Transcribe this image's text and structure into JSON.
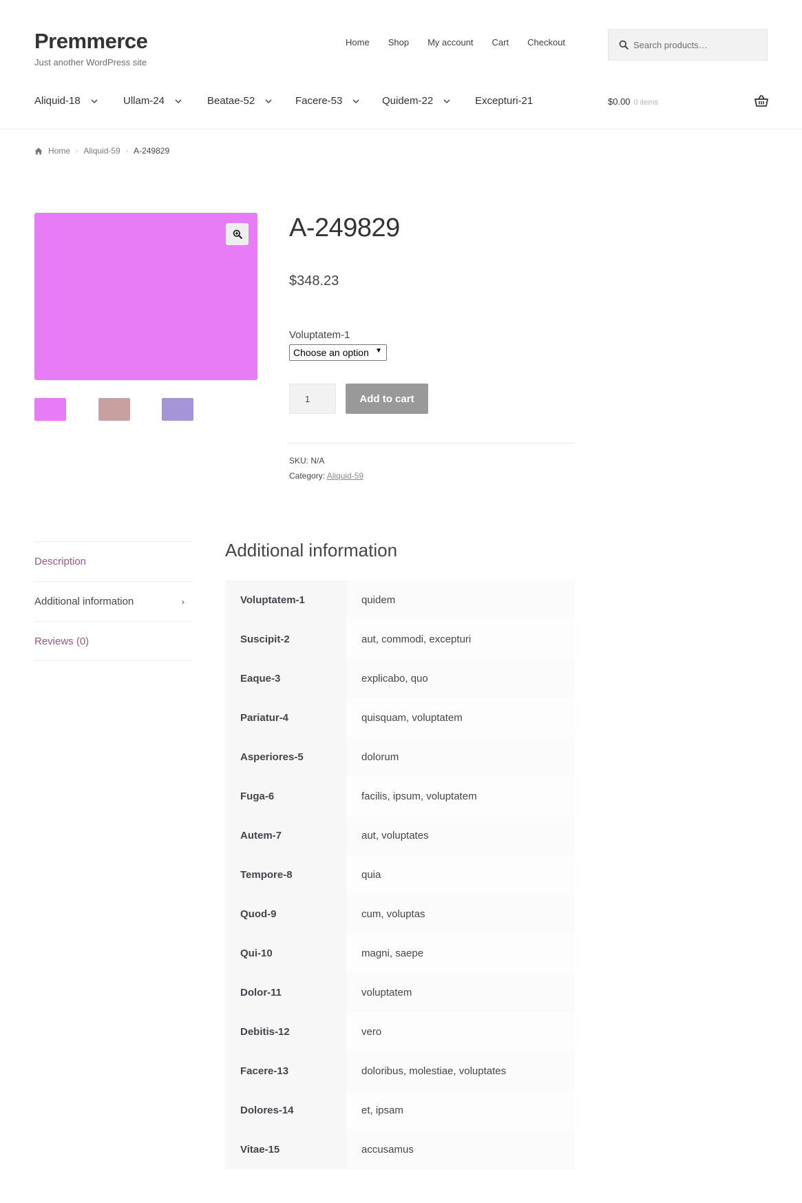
{
  "site": {
    "title": "Premmerce",
    "description": "Just another WordPress site"
  },
  "top_nav": [
    "Home",
    "Shop",
    "My account",
    "Cart",
    "Checkout"
  ],
  "search": {
    "placeholder": "Search products…"
  },
  "categories": [
    "Aliquid-18",
    "Ullam-24",
    "Beatae-52",
    "Facere-53",
    "Quidem-22",
    "Excepturi-21"
  ],
  "cart": {
    "amount": "$0.00",
    "count": "0 items"
  },
  "breadcrumb": {
    "home": "Home",
    "category": "Aliquid-59",
    "current": "A-249829"
  },
  "product": {
    "title": "A-249829",
    "price": "$348.23",
    "variation_label": "Voluptatem-1",
    "variation_selected": "Choose an option",
    "quantity": "1",
    "add_to_cart": "Add to cart",
    "sku_label": "SKU:",
    "sku_value": "N/A",
    "category_label": "Category:",
    "category_value": "Aliquid-59",
    "main_image_color": "#e87cf7",
    "thumb_colors": [
      "#e87cf7",
      "#c9a0a0",
      "#a594d8"
    ]
  },
  "tabs": [
    {
      "label": "Description",
      "active": false
    },
    {
      "label": "Additional information",
      "active": true
    },
    {
      "label": "Reviews (0)",
      "active": false
    }
  ],
  "additional_info": {
    "title": "Additional information",
    "rows": [
      {
        "name": "Voluptatem-1",
        "value": "quidem"
      },
      {
        "name": "Suscipit-2",
        "value": "aut, commodi, excepturi"
      },
      {
        "name": "Eaque-3",
        "value": "explicabo, quo"
      },
      {
        "name": "Pariatur-4",
        "value": "quisquam, voluptatem"
      },
      {
        "name": "Asperiores-5",
        "value": "dolorum"
      },
      {
        "name": "Fuga-6",
        "value": "facilis, ipsum, voluptatem"
      },
      {
        "name": "Autem-7",
        "value": "aut, voluptates"
      },
      {
        "name": "Tempore-8",
        "value": "quia"
      },
      {
        "name": "Quod-9",
        "value": "cum, voluptas"
      },
      {
        "name": "Qui-10",
        "value": "magni, saepe"
      },
      {
        "name": "Dolor-11",
        "value": "voluptatem"
      },
      {
        "name": "Debitis-12",
        "value": "vero"
      },
      {
        "name": "Facere-13",
        "value": "doloribus, molestiae, voluptates"
      },
      {
        "name": "Dolores-14",
        "value": "et, ipsam"
      },
      {
        "name": "Vitae-15",
        "value": "accusamus"
      }
    ]
  },
  "colors": {
    "accent_link": "#96588a",
    "button_bg": "#999999"
  }
}
